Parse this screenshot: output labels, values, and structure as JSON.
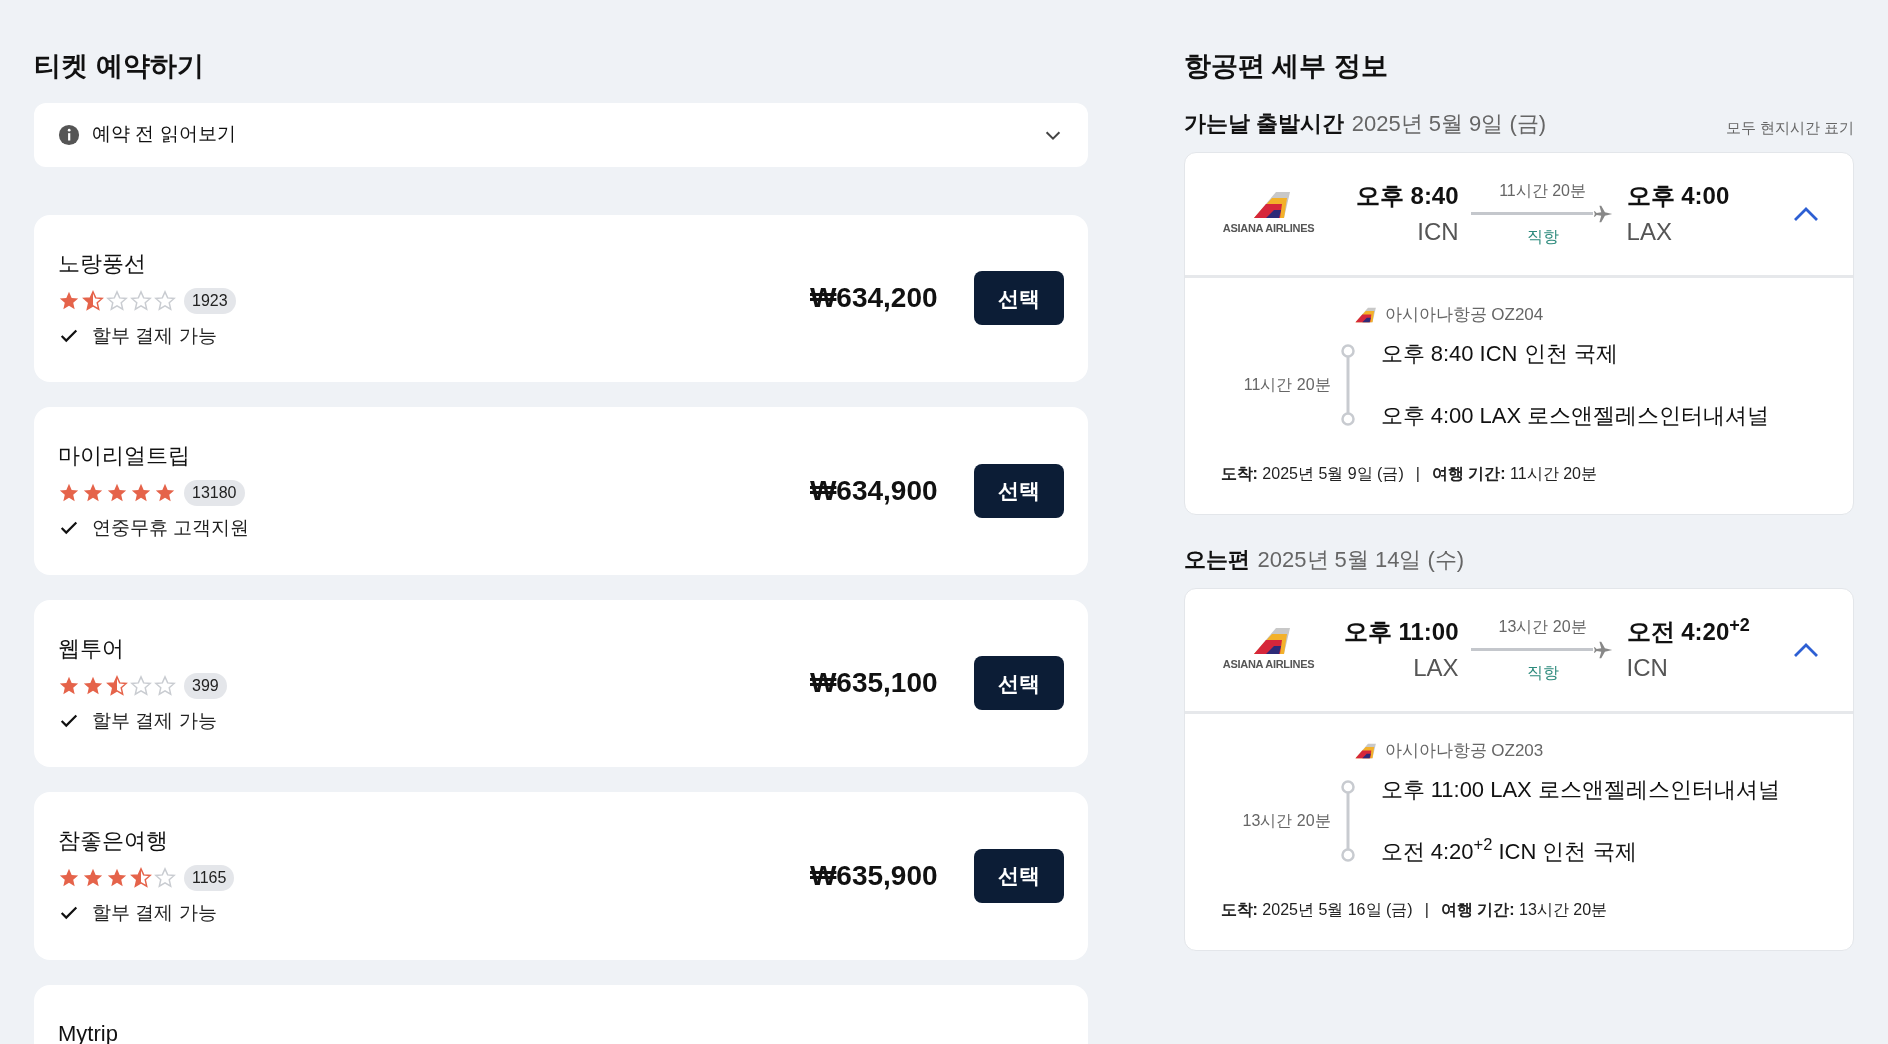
{
  "booking": {
    "title": "티켓 예약하기",
    "notice": {
      "label": "예약 전 읽어보기",
      "expanded": false
    },
    "agencies": [
      {
        "name": "노랑풍선",
        "stars": 1.5,
        "reviews": "1923",
        "feature": "할부 결제 가능",
        "price": "₩634,200",
        "button": "선택"
      },
      {
        "name": "마이리얼트립",
        "stars": 5,
        "reviews": "13180",
        "feature": "연중무휴 고객지원",
        "price": "₩634,900",
        "button": "선택"
      },
      {
        "name": "웹투어",
        "stars": 2.5,
        "reviews": "399",
        "feature": "할부 결제 가능",
        "price": "₩635,100",
        "button": "선택"
      },
      {
        "name": "참좋은여행",
        "stars": 3.5,
        "reviews": "1165",
        "feature": "할부 결제 가능",
        "price": "₩635,900",
        "button": "선택"
      },
      {
        "name": "Mytrip"
      }
    ]
  },
  "details": {
    "title": "항공편 세부 정보",
    "flights": [
      {
        "label": "가는날 출발시간",
        "date": "2025년 5월 9일 (금)",
        "note": "모두 현지시간 표기",
        "expanded": true,
        "logo_text": "ASIANA AIRLINES",
        "depart_time": "오후 8:40",
        "depart_code": "ICN",
        "duration": "11시간 20분",
        "stop_type": "직항",
        "arrive_time": "오후 4:00",
        "arrive_code": "LAX",
        "airline": "아시아나항공 OZ204",
        "segment_duration": "11시간 20분",
        "stops": [
          "오후 8:40 ICN 인천 국제",
          "오후 4:00 LAX 로스앤젤레스인터내셔널"
        ],
        "arrival": "**도착:** 2025년 5월 9일 (금)",
        "separator": "|",
        "travel_time": "**여행 기간:** 11시간 20분"
      },
      {
        "label": "오는편",
        "date": "2025년 5월 14일 (수)",
        "expanded": true,
        "logo_text": "ASIANA AIRLINES",
        "depart_time": "오후 11:00",
        "depart_code": "LAX",
        "duration": "13시간 20분",
        "stop_type": "직항",
        "arrive_time": "오전 4:20$^{+2}$",
        "arrive_code": "ICN",
        "airline": "아시아나항공 OZ203",
        "segment_duration": "13시간 20분",
        "stops": [
          "오후 11:00 LAX 로스앤젤레스인터내셔널",
          "오전 4:20$^{+2}$ ICN 인천 국제"
        ],
        "arrival": "**도착:** 2025년 5월 16일 (금)",
        "separator": "|",
        "travel_time": "**여행 기간:** 13시간 20분"
      }
    ]
  }
}
